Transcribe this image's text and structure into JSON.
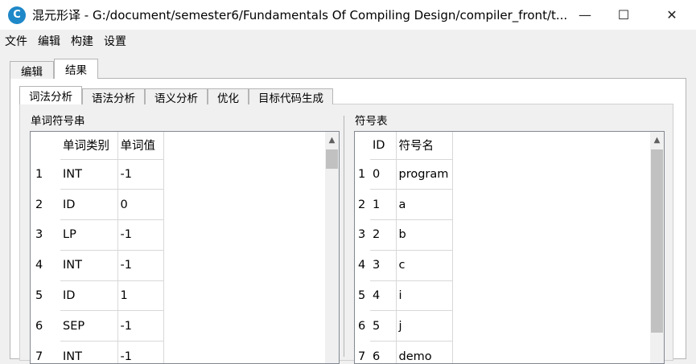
{
  "window": {
    "title": "混元形译 - G:/document/semester6/Fundamentals Of Compiling Design/compiler_front/t...",
    "icon_glyph": "C",
    "minimize": "—",
    "maximize": "☐",
    "close": "✕"
  },
  "menu": [
    "文件",
    "编辑",
    "构建",
    "设置"
  ],
  "outer_tabs": [
    "编辑",
    "结果"
  ],
  "inner_tabs": [
    "词法分析",
    "语法分析",
    "语义分析",
    "优化",
    "目标代码生成"
  ],
  "lexer_panel": {
    "label": "单词符号串",
    "headers": [
      "单词类别",
      "单词值"
    ],
    "rows": [
      {
        "n": "1",
        "type": "INT",
        "value": "-1"
      },
      {
        "n": "2",
        "type": "ID",
        "value": "0"
      },
      {
        "n": "3",
        "type": "LP",
        "value": "-1"
      },
      {
        "n": "4",
        "type": "INT",
        "value": "-1"
      },
      {
        "n": "5",
        "type": "ID",
        "value": "1"
      },
      {
        "n": "6",
        "type": "SEP",
        "value": "-1"
      },
      {
        "n": "7",
        "type": "INT",
        "value": "-1"
      }
    ]
  },
  "symbol_panel": {
    "label": "符号表",
    "headers": [
      "ID",
      "符号名"
    ],
    "rows": [
      {
        "n": "1",
        "id": "0",
        "name": "program"
      },
      {
        "n": "2",
        "id": "1",
        "name": "a"
      },
      {
        "n": "3",
        "id": "2",
        "name": "b"
      },
      {
        "n": "4",
        "id": "3",
        "name": "c"
      },
      {
        "n": "5",
        "id": "4",
        "name": "i"
      },
      {
        "n": "6",
        "id": "5",
        "name": "j"
      },
      {
        "n": "7",
        "id": "6",
        "name": "demo"
      }
    ]
  },
  "scroll_arrow_up": "▲"
}
